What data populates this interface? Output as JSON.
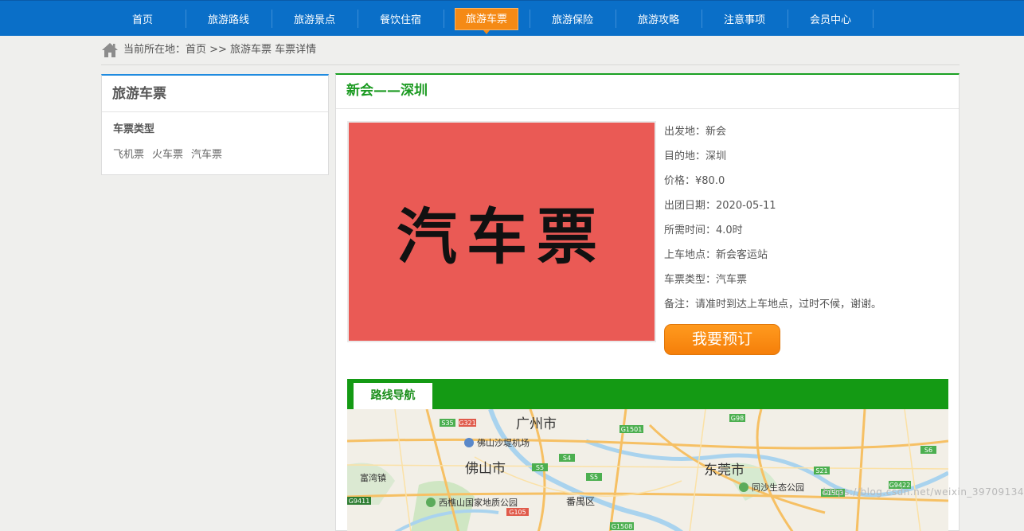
{
  "nav": {
    "items": [
      {
        "label": "首页"
      },
      {
        "label": "旅游路线"
      },
      {
        "label": "旅游景点"
      },
      {
        "label": "餐饮住宿"
      },
      {
        "label": "旅游车票",
        "active": true
      },
      {
        "label": "旅游保险"
      },
      {
        "label": "旅游攻略"
      },
      {
        "label": "注意事项"
      },
      {
        "label": "会员中心"
      }
    ],
    "colors": {
      "bar": "#0a6fc8",
      "active": "#f58a15"
    }
  },
  "breadcrumb": {
    "icon": "home-icon",
    "text": "当前所在地：首页 >> 旅游车票 车票详情"
  },
  "sidebar": {
    "title": "旅游车票",
    "subtitle": "车票类型",
    "links": [
      "飞机票",
      "火车票",
      "汽车票"
    ]
  },
  "detail": {
    "title": "新会——深圳",
    "image_text": "汽车票",
    "info": [
      "出发地：新会",
      "目的地：深圳",
      "价格：¥80.0",
      "出团日期：2020-05-11",
      "所需时间：4.0时",
      "上车地点：新会客运站",
      "车票类型：汽车票",
      "备注：请准时到达上车地点，过时不候，谢谢。"
    ],
    "book_button": "我要预订"
  },
  "route": {
    "tab_label": "路线导航",
    "map_labels": {
      "guangzhou": "广州市",
      "foshan": "佛山市",
      "dongguan": "东莞市",
      "airport": "佛山沙堤机场",
      "panyu": "番禺区",
      "park": "西樵山国家地质公园",
      "ecopark": "同沙生态公园",
      "fuyong": "富湾镇"
    }
  },
  "watermark": "https://blog.csdn.net/weixin_39709134"
}
